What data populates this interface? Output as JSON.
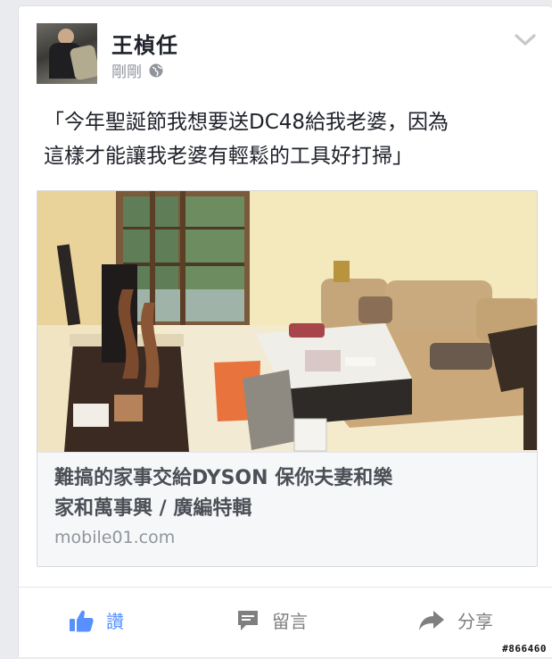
{
  "post": {
    "author": "王楨任",
    "time": "剛剛",
    "privacy_icon": "globe-icon",
    "menu_icon": "chevron-down-icon",
    "status_lines": [
      "「今年聖誕節我想要送DC48給我老婆，因為",
      "這樣才能讓我老婆有輕鬆的工具好打掃」"
    ]
  },
  "link": {
    "image_icon": "living-room-photo",
    "title_lines": [
      "難搞的家事交給DYSON 保你夫妻和樂",
      "家和萬事興 / 廣編特輯"
    ],
    "domain": "mobile01.com"
  },
  "actions": {
    "like_label": "讚",
    "comment_label": "留言",
    "share_label": "分享",
    "like_color": "#5890ff",
    "muted_color": "#7f7f7f"
  },
  "watermark": "#866460"
}
